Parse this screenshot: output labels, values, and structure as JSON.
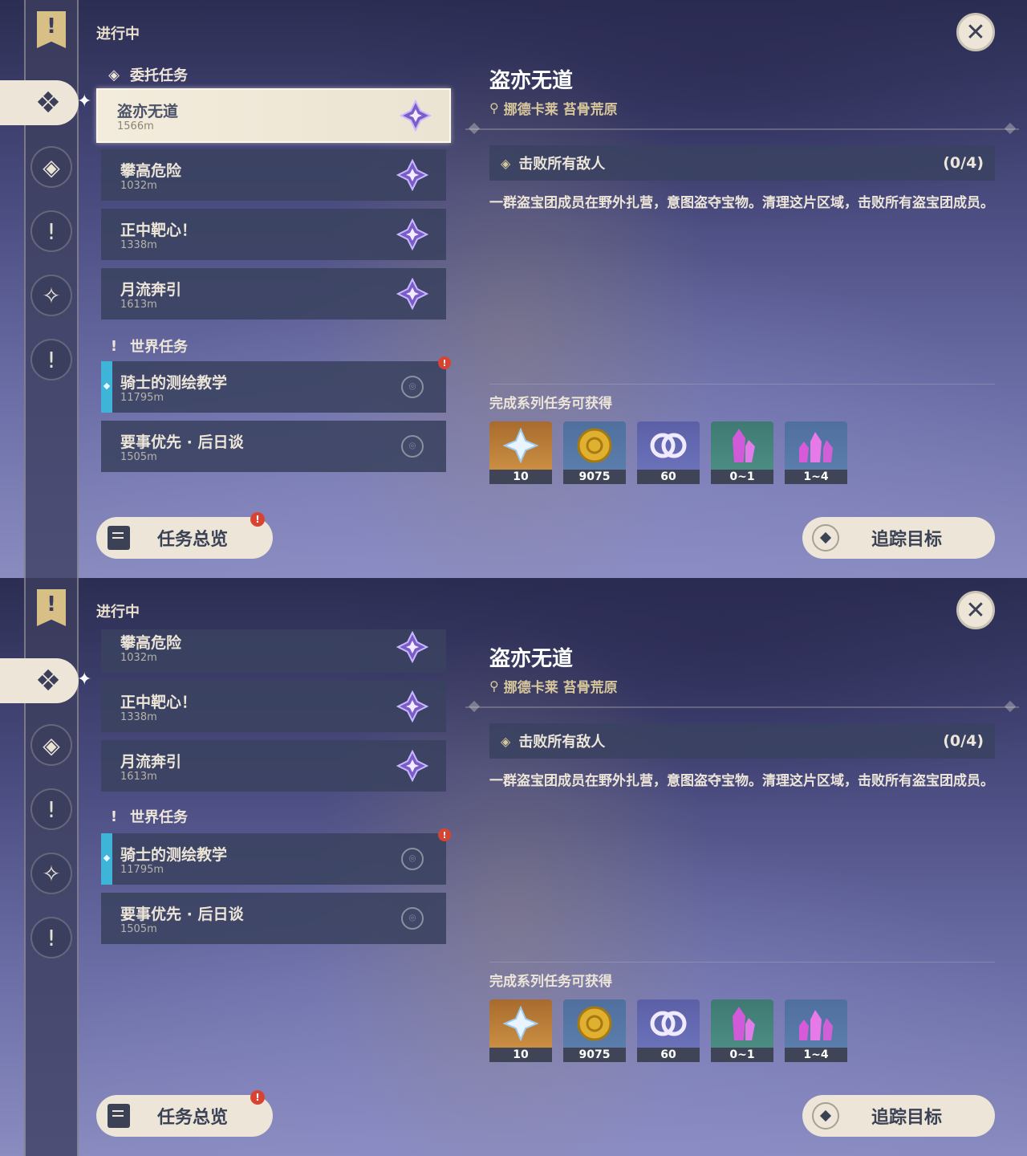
{
  "header": {
    "status": "进行中"
  },
  "groups": {
    "commission": "委托任务",
    "world": "世界任务"
  },
  "quests": [
    {
      "title": "盗亦无道",
      "distance": "1566m"
    },
    {
      "title": "攀高危险",
      "distance": "1032m"
    },
    {
      "title": "正中靶心！",
      "distance": "1338m"
    },
    {
      "title": "月流奔引",
      "distance": "1613m"
    },
    {
      "title": "骑士的测绘教学",
      "distance": "11795m"
    },
    {
      "title": "要事优先 · 后日谈",
      "distance": "1505m"
    }
  ],
  "detail": {
    "title": "盗亦无道",
    "location": "挪德卡莱 苔骨荒原",
    "objective": "击败所有敌人",
    "progress": "(0/4)",
    "description": "一群盗宝团成员在野外扎营，意图盗夺宝物。清理这片区域，击败所有盗宝团成员。",
    "rewards_label": "完成系列任务可获得",
    "rewards": [
      {
        "icon": "primogem-icon",
        "count": "10"
      },
      {
        "icon": "mora-icon",
        "count": "9075"
      },
      {
        "icon": "companionship-exp-icon",
        "count": "60"
      },
      {
        "icon": "ascension-crystal-icon",
        "count": "0~1"
      },
      {
        "icon": "crystal-cluster-icon",
        "count": "1~4"
      }
    ]
  },
  "buttons": {
    "overview": "任务总览",
    "track": "追踪目标",
    "alert": "!"
  },
  "colors": {
    "accent": "#ece5d8",
    "panel": "#3a4260",
    "alert": "#d84432",
    "track_bar": "#3eb4d8"
  }
}
